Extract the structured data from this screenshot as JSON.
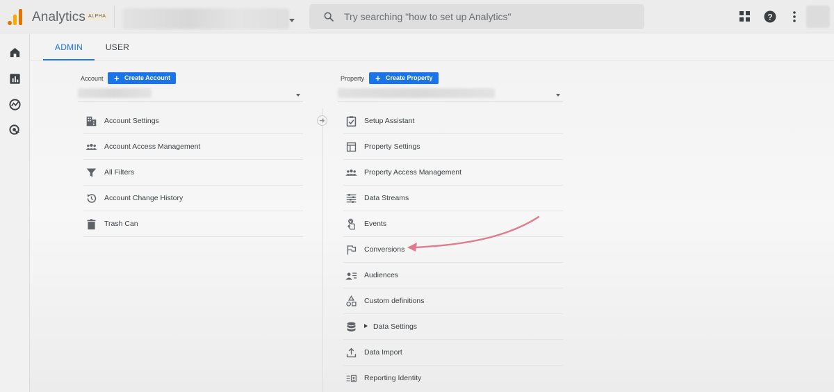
{
  "header": {
    "app_title": "Analytics",
    "badge": "ALPHA",
    "search_placeholder": "Try searching \"how to set up Analytics\""
  },
  "tabs": [
    {
      "label": "ADMIN",
      "active": true
    },
    {
      "label": "USER",
      "active": false
    }
  ],
  "account_column": {
    "label": "Account",
    "create_button": "Create Account",
    "items": [
      {
        "label": "Account Settings",
        "icon": "building-icon"
      },
      {
        "label": "Account Access Management",
        "icon": "people-icon"
      },
      {
        "label": "All Filters",
        "icon": "filter-icon"
      },
      {
        "label": "Account Change History",
        "icon": "history-icon"
      },
      {
        "label": "Trash Can",
        "icon": "trash-icon"
      }
    ]
  },
  "property_column": {
    "label": "Property",
    "create_button": "Create Property",
    "items": [
      {
        "label": "Setup Assistant",
        "icon": "checkbox-icon"
      },
      {
        "label": "Property Settings",
        "icon": "layout-icon"
      },
      {
        "label": "Property Access Management",
        "icon": "people-icon"
      },
      {
        "label": "Data Streams",
        "icon": "streams-icon"
      },
      {
        "label": "Events",
        "icon": "touch-icon"
      },
      {
        "label": "Conversions",
        "icon": "flag-icon"
      },
      {
        "label": "Audiences",
        "icon": "audience-icon"
      },
      {
        "label": "Custom definitions",
        "icon": "shapes-icon"
      },
      {
        "label": "Data Settings",
        "icon": "database-icon"
      },
      {
        "label": "Data Import",
        "icon": "upload-icon"
      },
      {
        "label": "Reporting Identity",
        "icon": "identity-icon"
      }
    ]
  },
  "colors": {
    "accent": "#1a73e8",
    "annotation_arrow": "#e07b8e",
    "logo_orange": "#e37400",
    "logo_yellow": "#f9ab00"
  }
}
